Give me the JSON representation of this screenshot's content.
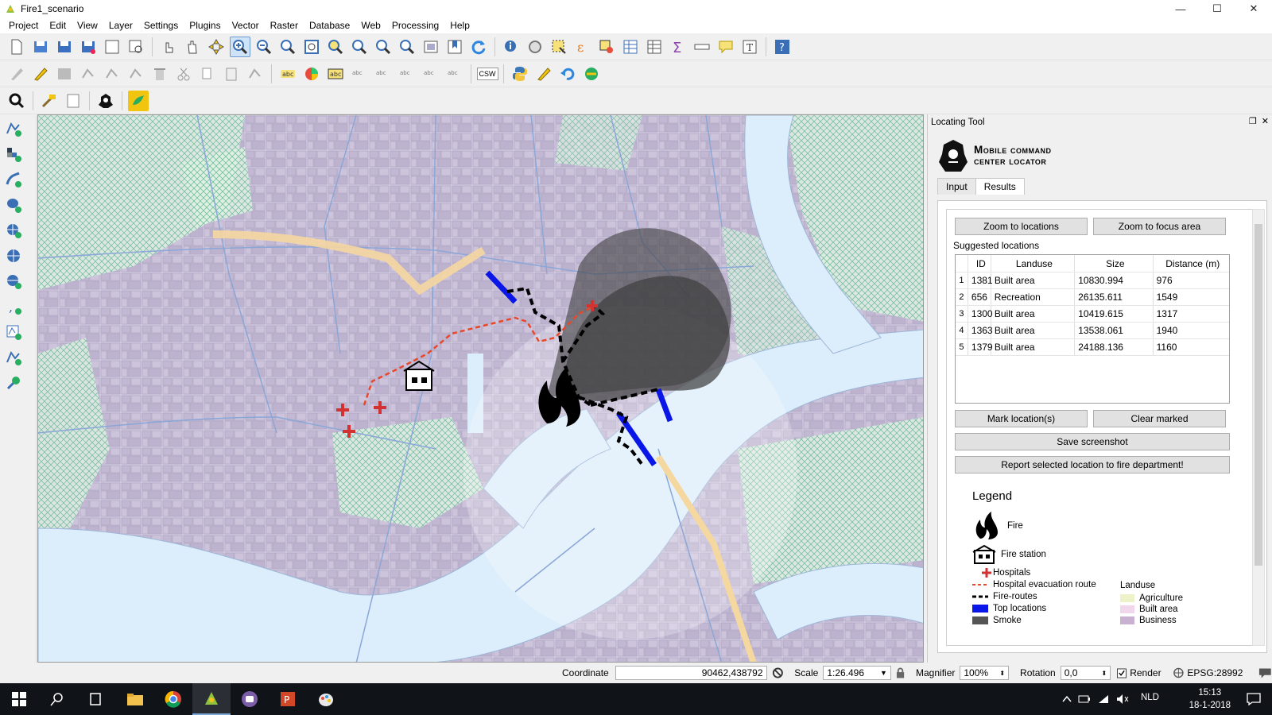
{
  "window": {
    "title": "Fire1_scenario",
    "minimize": "—",
    "maximize": "☐",
    "close": "✕"
  },
  "menu": [
    "Project",
    "Edit",
    "View",
    "Layer",
    "Settings",
    "Plugins",
    "Vector",
    "Raster",
    "Database",
    "Web",
    "Processing",
    "Help"
  ],
  "toolbar": {
    "csw_label": "CSW"
  },
  "map": {
    "colors": {
      "water": "#dceefb",
      "built": "#d7cfe3",
      "green": "#d5ecd7",
      "road": "#8aa7d8",
      "smoke": "#3f3f3f",
      "fire_route": "#000000",
      "evac_route": "#e8482a",
      "top_location": "#0a16e8",
      "hospital": "#d23232"
    }
  },
  "panel": {
    "title": "Locating Tool",
    "brand_line1": "Mobile command",
    "brand_line2": "center locator",
    "tabs": [
      {
        "label": "Input"
      },
      {
        "label": "Results"
      }
    ],
    "buttons": {
      "zoom_locations": "Zoom to locations",
      "zoom_focus": "Zoom to focus area",
      "mark": "Mark location(s)",
      "clear": "Clear marked",
      "save": "Save screenshot",
      "report": "Report selected location to fire department!"
    },
    "suggested_label": "Suggested locations",
    "table": {
      "columns": [
        "ID",
        "Landuse",
        "Size",
        "Distance (m)"
      ],
      "rows": [
        {
          "n": "1",
          "id": "1381",
          "landuse": "Built area",
          "size": "10830.994",
          "distance": "976"
        },
        {
          "n": "2",
          "id": "656",
          "landuse": "Recreation",
          "size": "26135.611",
          "distance": "1549"
        },
        {
          "n": "3",
          "id": "1300",
          "landuse": "Built area",
          "size": "10419.615",
          "distance": "1317"
        },
        {
          "n": "4",
          "id": "1363",
          "landuse": "Built area",
          "size": "13538.061",
          "distance": "1940"
        },
        {
          "n": "5",
          "id": "1379",
          "landuse": "Built area",
          "size": "24188.136",
          "distance": "1160"
        }
      ]
    },
    "legend": {
      "title": "Legend",
      "fire": "Fire",
      "fire_station": "Fire station",
      "hospitals": "Hospitals",
      "evac": "Hospital evacuation route",
      "fire_routes": "Fire-routes",
      "top_locations": "Top locations",
      "smoke": "Smoke",
      "landuse_title": "Landuse",
      "agriculture": "Agriculture",
      "built_area": "Built area",
      "business": "Business"
    }
  },
  "status": {
    "coordinate_label": "Coordinate",
    "coordinate_value": "90462,438792",
    "scale_label": "Scale",
    "scale_value": "1:26.496",
    "magnifier_label": "Magnifier",
    "magnifier_value": "100%",
    "rotation_label": "Rotation",
    "rotation_value": "0,0",
    "render_label": "Render",
    "crs": "EPSG:28992"
  },
  "taskbar": {
    "lang": "NLD",
    "time": "15:13",
    "date": "18-1-2018"
  }
}
